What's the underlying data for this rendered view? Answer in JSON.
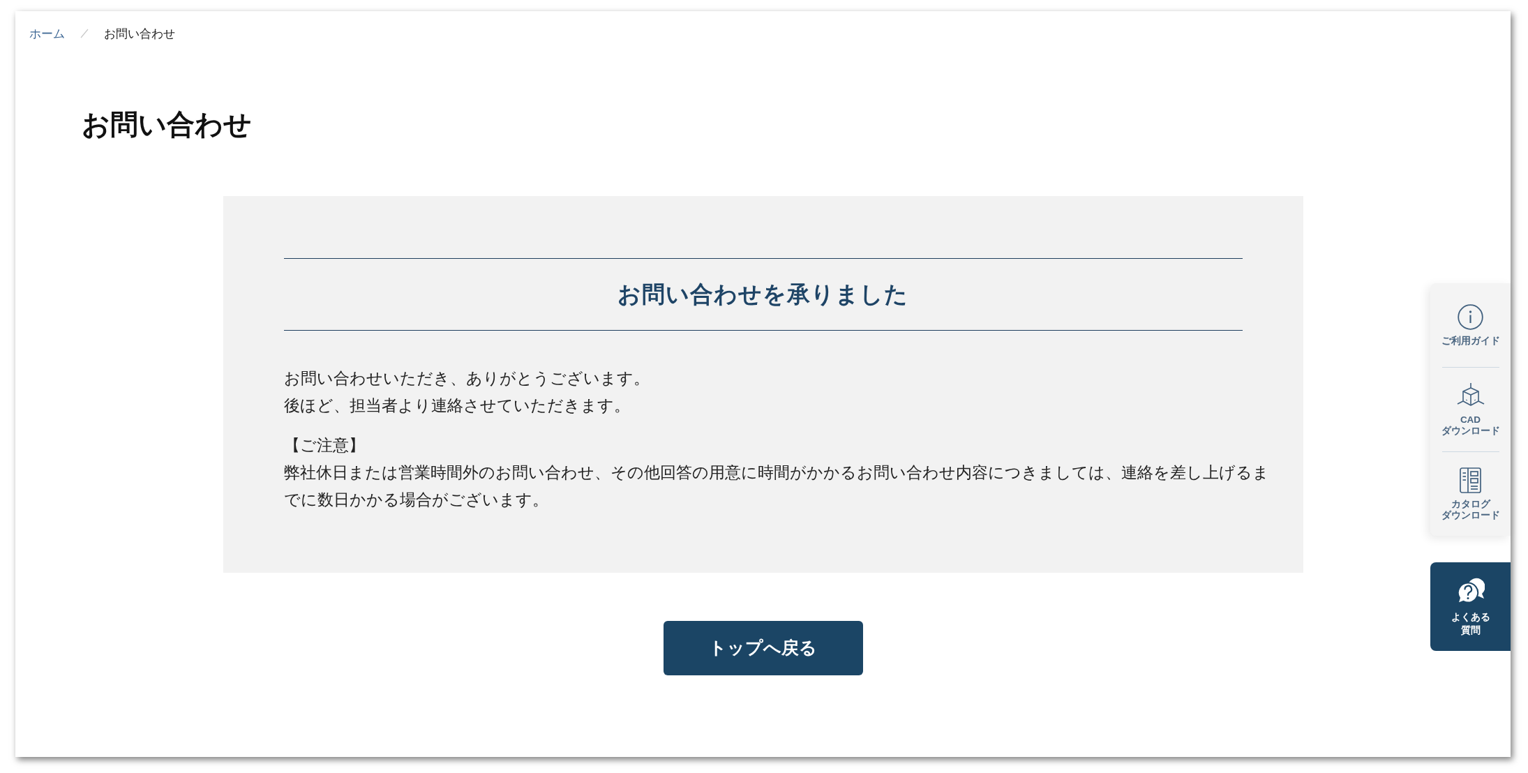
{
  "breadcrumb": [
    {
      "label": "ホーム",
      "kind": "link"
    },
    {
      "label": "お問い合わせ",
      "kind": "current"
    }
  ],
  "page_title": "お問い合わせ",
  "message_card": {
    "heading": "お問い合わせを承りました",
    "paragraphs": [
      {
        "lines": [
          "お問い合わせいただき、ありがとうございます。",
          "後ほど、担当者より連絡させていただきます。"
        ]
      },
      {
        "lines": [
          "【ご注意】",
          "弊社休日または営業時間外のお問い合わせ、その他回答の用意に時間がかかるお問い合わせ内容につきましては、連絡を差し上げるまでに数日かかる場合がございます。"
        ]
      }
    ]
  },
  "back_button": {
    "label": "トップへ戻る"
  },
  "side_menu": {
    "items": [
      {
        "label_lines": [
          "ご利用ガイド"
        ]
      },
      {
        "label_lines": [
          "CAD",
          "ダウンロード"
        ]
      },
      {
        "label_lines": [
          "カタログ",
          "ダウンロード"
        ]
      }
    ]
  },
  "faq_button": {
    "label_lines": [
      "よくある",
      "質問"
    ]
  }
}
